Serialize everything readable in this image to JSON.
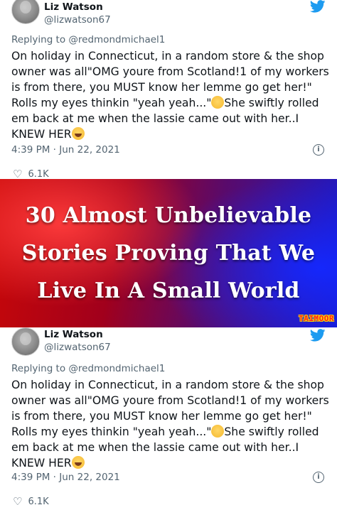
{
  "tweet": {
    "author_name": "Liz Watson",
    "author_handle": "@lizwatson67",
    "replying_to_prefix": "Replying to",
    "replying_to_handle": "@redmondmichael1",
    "text_part1": "On holiday in Connecticut, in a random store & the shop owner was all\"OMG youre from Scotland!1 of my workers is from there, you MUST know her lemme go get her!\" Rolls my eyes thinkin \"yeah yeah...\"",
    "text_part2": "She swiftly rolled em back at me when the lassie came out with her..I KNEW HER",
    "emoji_1": "face-with-rolling-eyes",
    "emoji_2": "face-with-tears-of-joy",
    "timestamp": "4:39 PM · Jun 22, 2021",
    "likes": "6.1K",
    "brand_color": "#1d9bf0"
  },
  "banner": {
    "line1": "30 Almost Unbelievable",
    "line2": "Stories Proving That We",
    "line3": "Live In A Small World",
    "watermark": "TAIMOOR",
    "colors": {
      "left": "#c80808",
      "right": "#1a1ac8",
      "watermark": "#ff2020"
    }
  }
}
